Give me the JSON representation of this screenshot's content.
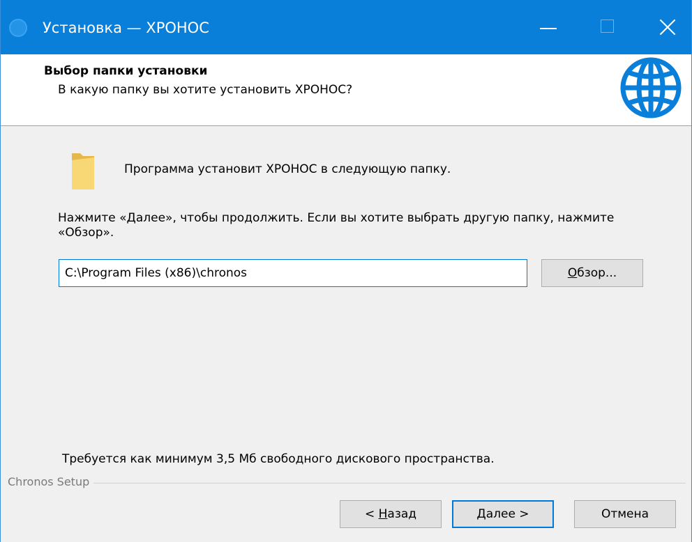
{
  "window": {
    "title": "Установка — ХРОНОС",
    "accent_color": "#0a7fd9"
  },
  "header": {
    "title": "Выбор папки установки",
    "subtitle": "В какую папку вы хотите установить ХРОНОС?",
    "icon": "globe-icon"
  },
  "content": {
    "destination_text": "Программа установит ХРОНОС в следующую папку.",
    "instruction_text": "Нажмите «Далее», чтобы продолжить. Если вы хотите выбрать другую папку, нажмите «Обзор».",
    "path_value": "C:\\Program Files (x86)\\chronos",
    "browse_label_underlined": "О",
    "browse_label_rest": "бзор...",
    "disk_space_text": "Требуется как минимум 3,5 Мб свободного дискового пространства."
  },
  "footer": {
    "group_label": "Chronos Setup",
    "back_prefix": "< ",
    "back_underlined": "Н",
    "back_rest": "азад",
    "next_underlined": "Д",
    "next_rest": "алее >",
    "cancel_label": "Отмена"
  }
}
